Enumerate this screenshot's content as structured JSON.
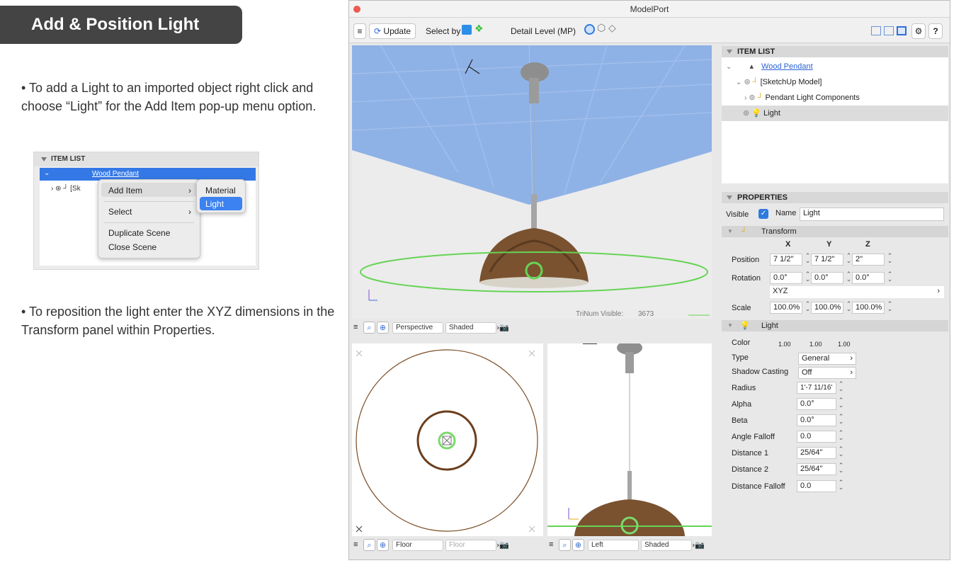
{
  "instructions": {
    "banner_title": "Add & Position Light",
    "bullet1": "To add a Light to an imported object right click and choose “Light” for the Add Item pop-up menu option.",
    "bullet2": "To reposition the light enter the XYZ dimensions in the Transform panel within Properties."
  },
  "mini_menu": {
    "header": "ITEM LIST",
    "selected_item": "Wood Pendant",
    "row2_prefix": "[Sk",
    "items": [
      "Add Item",
      "Select",
      "Duplicate Scene",
      "Close Scene"
    ],
    "submenu": [
      "Material",
      "Light"
    ]
  },
  "app": {
    "title": "ModelPort",
    "toolbar": {
      "update_label": "Update",
      "select_by_label": "Select by",
      "detail_level_label": "Detail Level (MP)",
      "help_label": "?"
    },
    "viewports": {
      "main": {
        "tri_count_label": "TriNum Visible:",
        "tri_count": "3673",
        "camera": "Perspective",
        "render": "Shaded"
      },
      "floor": {
        "camera": "Floor",
        "render": "Floor"
      },
      "left": {
        "camera": "Left",
        "render": "Shaded"
      }
    },
    "item_list": {
      "header": "ITEM LIST",
      "items": [
        "Wood Pendant",
        "[SketchUp Model]",
        "Pendant Light Components",
        "Light"
      ]
    },
    "properties": {
      "header": "PROPERTIES",
      "visible_label": "Visible",
      "name_label": "Name",
      "name_value": "Light",
      "transform": {
        "header": "Transform",
        "col_x": "X",
        "col_y": "Y",
        "col_z": "Z",
        "position_label": "Position",
        "position": [
          "7 1/2\"",
          "7 1/2\"",
          "2\""
        ],
        "rotation_label": "Rotation",
        "rotation": [
          "0.0°",
          "0.0°",
          "0.0°"
        ],
        "order": "XYZ",
        "scale_label": "Scale",
        "scale": [
          "100.0%",
          "100.0%",
          "100.0%"
        ]
      },
      "light": {
        "header": "Light",
        "color_label": "Color",
        "color": [
          "1.00",
          "1.00",
          "1.00"
        ],
        "type_label": "Type",
        "type_value": "General",
        "shadow_label": "Shadow Casting",
        "shadow_value": "Off",
        "radius_label": "Radius",
        "radius_value": "1'-7 11/16'",
        "alpha_label": "Alpha",
        "alpha_value": "0.0°",
        "beta_label": "Beta",
        "beta_value": "0.0°",
        "angle_falloff_label": "Angle Falloff",
        "angle_falloff_value": "0.0",
        "distance1_label": "Distance 1",
        "distance1_value": "25/64\"",
        "distance2_label": "Distance 2",
        "distance2_value": "25/64\"",
        "distance_falloff_label": "Distance Falloff",
        "distance_falloff_value": "0.0"
      }
    }
  }
}
